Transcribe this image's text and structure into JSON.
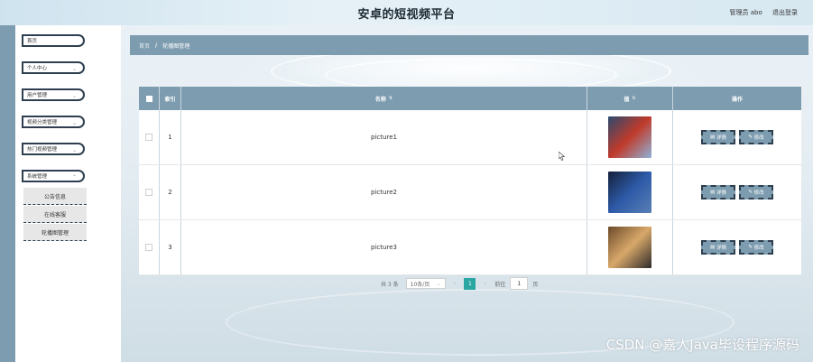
{
  "app": {
    "title": "安卓的短视频平台"
  },
  "header": {
    "admin_label": "管理员 abo",
    "logout_label": "退出登录"
  },
  "sidebar": {
    "items": [
      {
        "label": "首页",
        "has_submenu": false
      },
      {
        "label": "个人中心",
        "has_submenu": true
      },
      {
        "label": "用户管理",
        "has_submenu": true
      },
      {
        "label": "视频分类管理",
        "has_submenu": true
      },
      {
        "label": "热门视频管理",
        "has_submenu": true
      },
      {
        "label": "系统管理",
        "has_submenu": true,
        "expanded": true
      }
    ],
    "subitems": [
      {
        "label": "公告信息"
      },
      {
        "label": "在线客服"
      },
      {
        "label": "轮播图管理",
        "active": true
      }
    ]
  },
  "breadcrumb": {
    "home": "首页",
    "separator": "/",
    "current": "轮播图管理"
  },
  "table": {
    "columns": {
      "index": "索引",
      "name": "名称",
      "value": "值",
      "actions": "操作"
    },
    "rows": [
      {
        "index": "1",
        "name": "picture1",
        "thumb_colors": [
          "#2a4a6e",
          "#c03a2b",
          "#8fb2d6"
        ]
      },
      {
        "index": "2",
        "name": "picture2",
        "thumb_colors": [
          "#14213a",
          "#2d5aa8",
          "#5a7fb5"
        ]
      },
      {
        "index": "3",
        "name": "picture3",
        "thumb_colors": [
          "#6b4a2a",
          "#d8a86a",
          "#2e2a28"
        ]
      }
    ],
    "actions": {
      "detail": "详情",
      "edit": "修改"
    }
  },
  "pagination": {
    "total_text": "共 3 条",
    "page_size": "10条/页",
    "current_page": "1",
    "goto_label": "前往",
    "goto_value": "1",
    "page_suffix": "页"
  },
  "watermark": "CSDN @嘉人Java毕设程序源码",
  "colors": {
    "accent": "#7d9caf",
    "dark_border": "#2e3f4f",
    "page_active": "#2ba7a3"
  }
}
